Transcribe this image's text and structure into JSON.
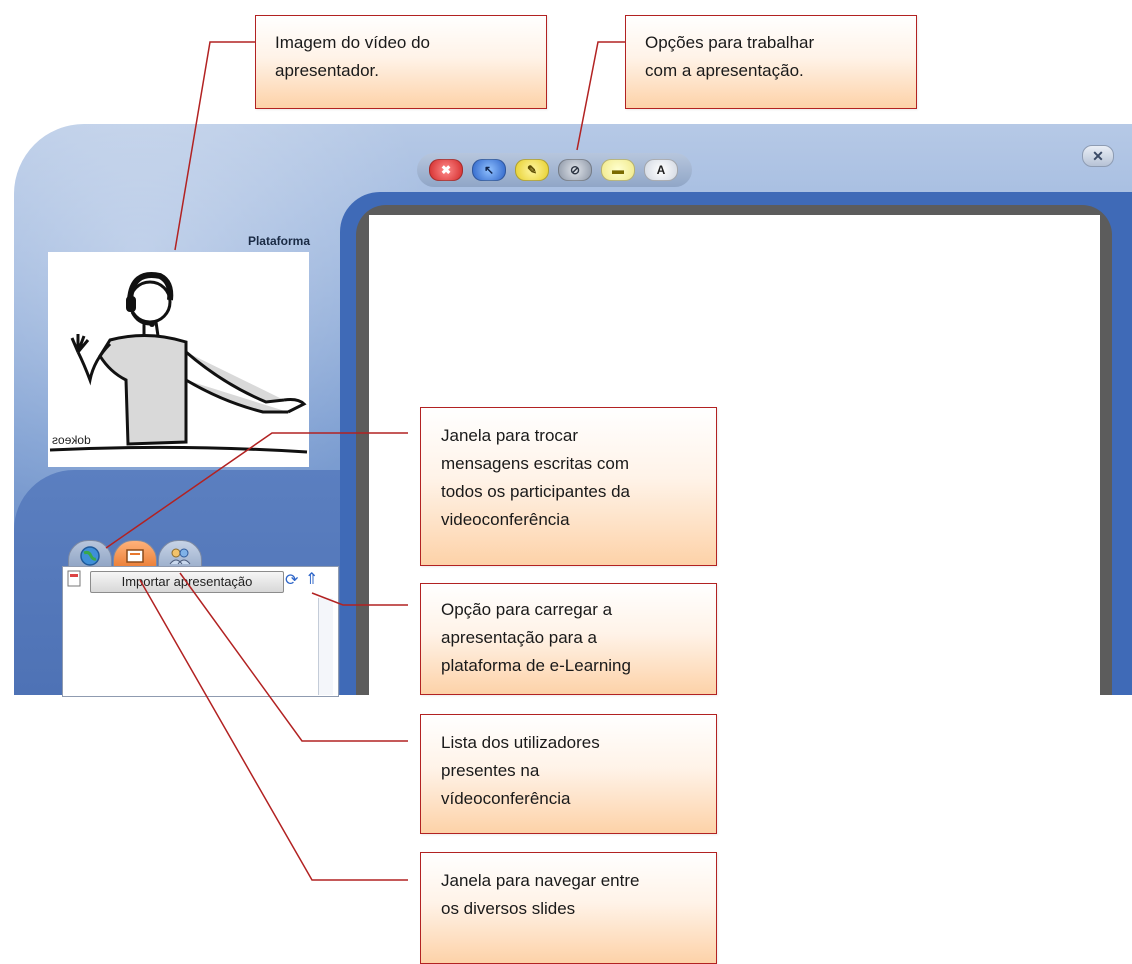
{
  "callouts": {
    "presenter_video": "Imagem do vídeo do\napresentador.",
    "presentation_options": "Opções para trabalhar\ncom a apresentação.",
    "chat_window": "Janela para trocar\nmensagens escritas com\ntodos os participantes da\nvideoconferência",
    "upload_option": "Opção para carregar a\napresentação para a\nplataforma de e-Learning",
    "users_list": "Lista dos utilizadores\npresentes na\nvídeoconferência",
    "slides_navigation": "Janela para navegar entre\nos diversos slides"
  },
  "app": {
    "platform_label": "Plataforma",
    "video_watermark": "dokeos",
    "close_symbol": "✕",
    "toolbar": [
      {
        "name": "clear-tool-button",
        "glyph": "✖",
        "style": "red"
      },
      {
        "name": "pointer-tool-button",
        "glyph": "↖",
        "style": "blue"
      },
      {
        "name": "pencil-tool-button",
        "glyph": "✎",
        "style": "yellow"
      },
      {
        "name": "eraser-tool-button",
        "glyph": "⊘",
        "style": "gray"
      },
      {
        "name": "highlighter-tool-button",
        "glyph": "▬",
        "style": "light"
      },
      {
        "name": "text-tool-button",
        "glyph": "A",
        "style": "white"
      }
    ],
    "panel": {
      "import_label": "Importar apresentação",
      "refresh_symbol": "⟳",
      "upload_symbol": "⇑"
    }
  }
}
